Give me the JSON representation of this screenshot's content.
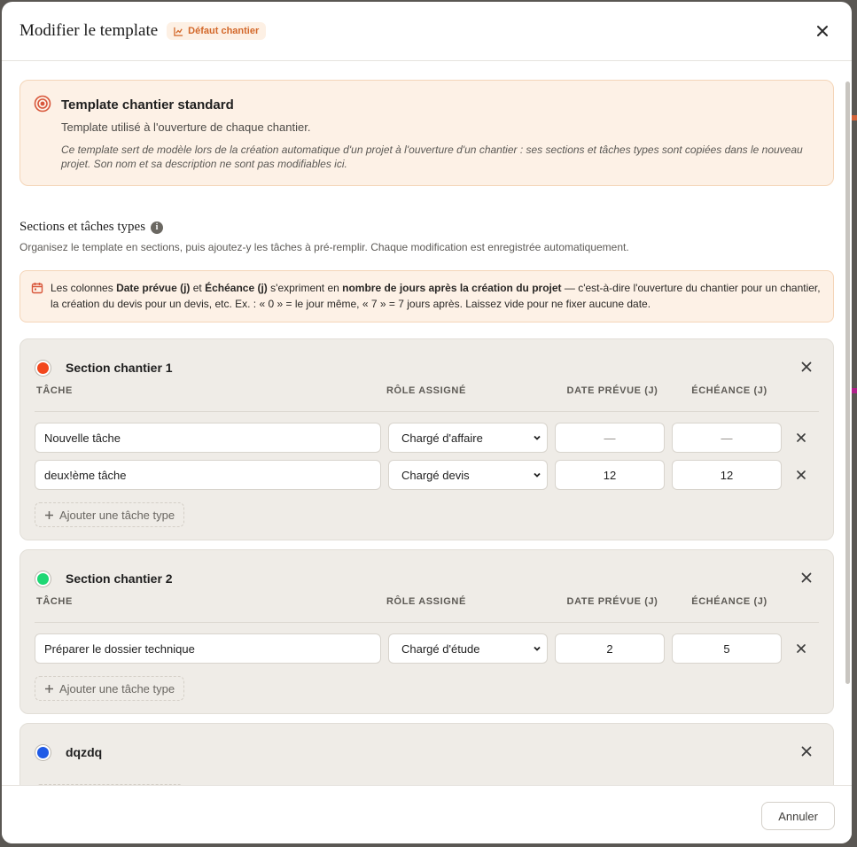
{
  "modal": {
    "title": "Modifier le template",
    "badge": "Défaut chantier",
    "close_label": "Fermer"
  },
  "info": {
    "title": "Template chantier standard",
    "subtitle": "Template utilisé à l'ouverture de chaque chantier.",
    "note": "Ce template sert de modèle lors de la création automatique d'un projet à l'ouverture d'un chantier : ses sections et tâches types sont copiées dans le nouveau projet. Son nom et sa description ne sont pas modifiables ici."
  },
  "sections_header": {
    "title": "Sections et tâches types",
    "description": "Organisez le template en sections, puis ajoutez-y les tâches à pré-remplir. Chaque modification est enregistrée automatiquement."
  },
  "warning": {
    "p1": "Les colonnes ",
    "b1": "Date prévue (j)",
    "p2": " et ",
    "b2": "Échéance (j)",
    "p3": " s'expriment en ",
    "b3": "nombre de jours après la création du projet",
    "p4": " — c'est-à-dire l'ouverture du chantier pour un chantier, la création du devis pour un devis, etc. Ex. : « 0 » = le jour même, « 7 » = 7 jours après. Laissez vide pour ne fixer aucune date."
  },
  "columns": {
    "task": "TÂCHE",
    "role": "RÔLE ASSIGNÉ",
    "date": "DATE PRÉVUE (J)",
    "due": "ÉCHÉANCE (J)"
  },
  "add_task_label": "Ajouter une tâche type",
  "sections": [
    {
      "name": "Section chantier 1",
      "color": "#f2471d",
      "tasks": [
        {
          "name": "Nouvelle tâche",
          "role": "Chargé d'affaire",
          "date": "—",
          "due": "—"
        },
        {
          "name": "deux!ème tâche",
          "role": "Chargé devis",
          "date": "12",
          "due": "12"
        }
      ]
    },
    {
      "name": "Section chantier 2",
      "color": "#1ed774",
      "tasks": [
        {
          "name": "Préparer le dossier technique",
          "role": "Chargé d'étude",
          "date": "2",
          "due": "5"
        }
      ]
    },
    {
      "name": "dqzdq",
      "color": "#1f5ae6",
      "tasks": []
    }
  ],
  "footer": {
    "cancel": "Annuler"
  }
}
